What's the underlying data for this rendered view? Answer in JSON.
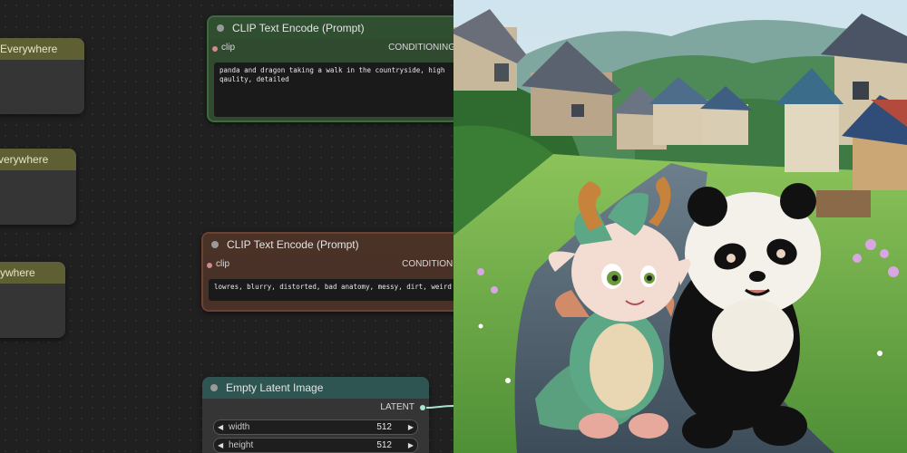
{
  "nodes": {
    "anything_everywhere": [
      {
        "title": "Everywhere"
      },
      {
        "title": "verywhere"
      },
      {
        "title": "ywhere"
      }
    ],
    "clip_positive": {
      "title": "CLIP Text Encode (Prompt)",
      "input_label": "clip",
      "output_label": "CONDITIONING",
      "text": "panda and dragon taking a walk in the countryside, high qaulity, detailed"
    },
    "clip_negative": {
      "title": "CLIP Text Encode (Prompt)",
      "input_label": "clip",
      "output_label": "CONDITIONI",
      "text": "lowres, blurry, distorted, bad anatomy, messy, dirt, weird"
    },
    "empty_latent": {
      "title": "Empty Latent Image",
      "output_label": "LATENT",
      "widgets": [
        {
          "name": "width",
          "value": "512"
        },
        {
          "name": "height",
          "value": "512"
        }
      ]
    }
  },
  "colors": {
    "canvas_bg": "#202020",
    "ae_header": "#5f5f34",
    "clip_positive": "#2f4a2f",
    "clip_negative": "#4a3128",
    "latent_header": "#2e5551",
    "link": "#a8e6cf"
  },
  "preview_image": {
    "subject": "cartoon baby dragon and panda walking on a countryside path with houses"
  }
}
